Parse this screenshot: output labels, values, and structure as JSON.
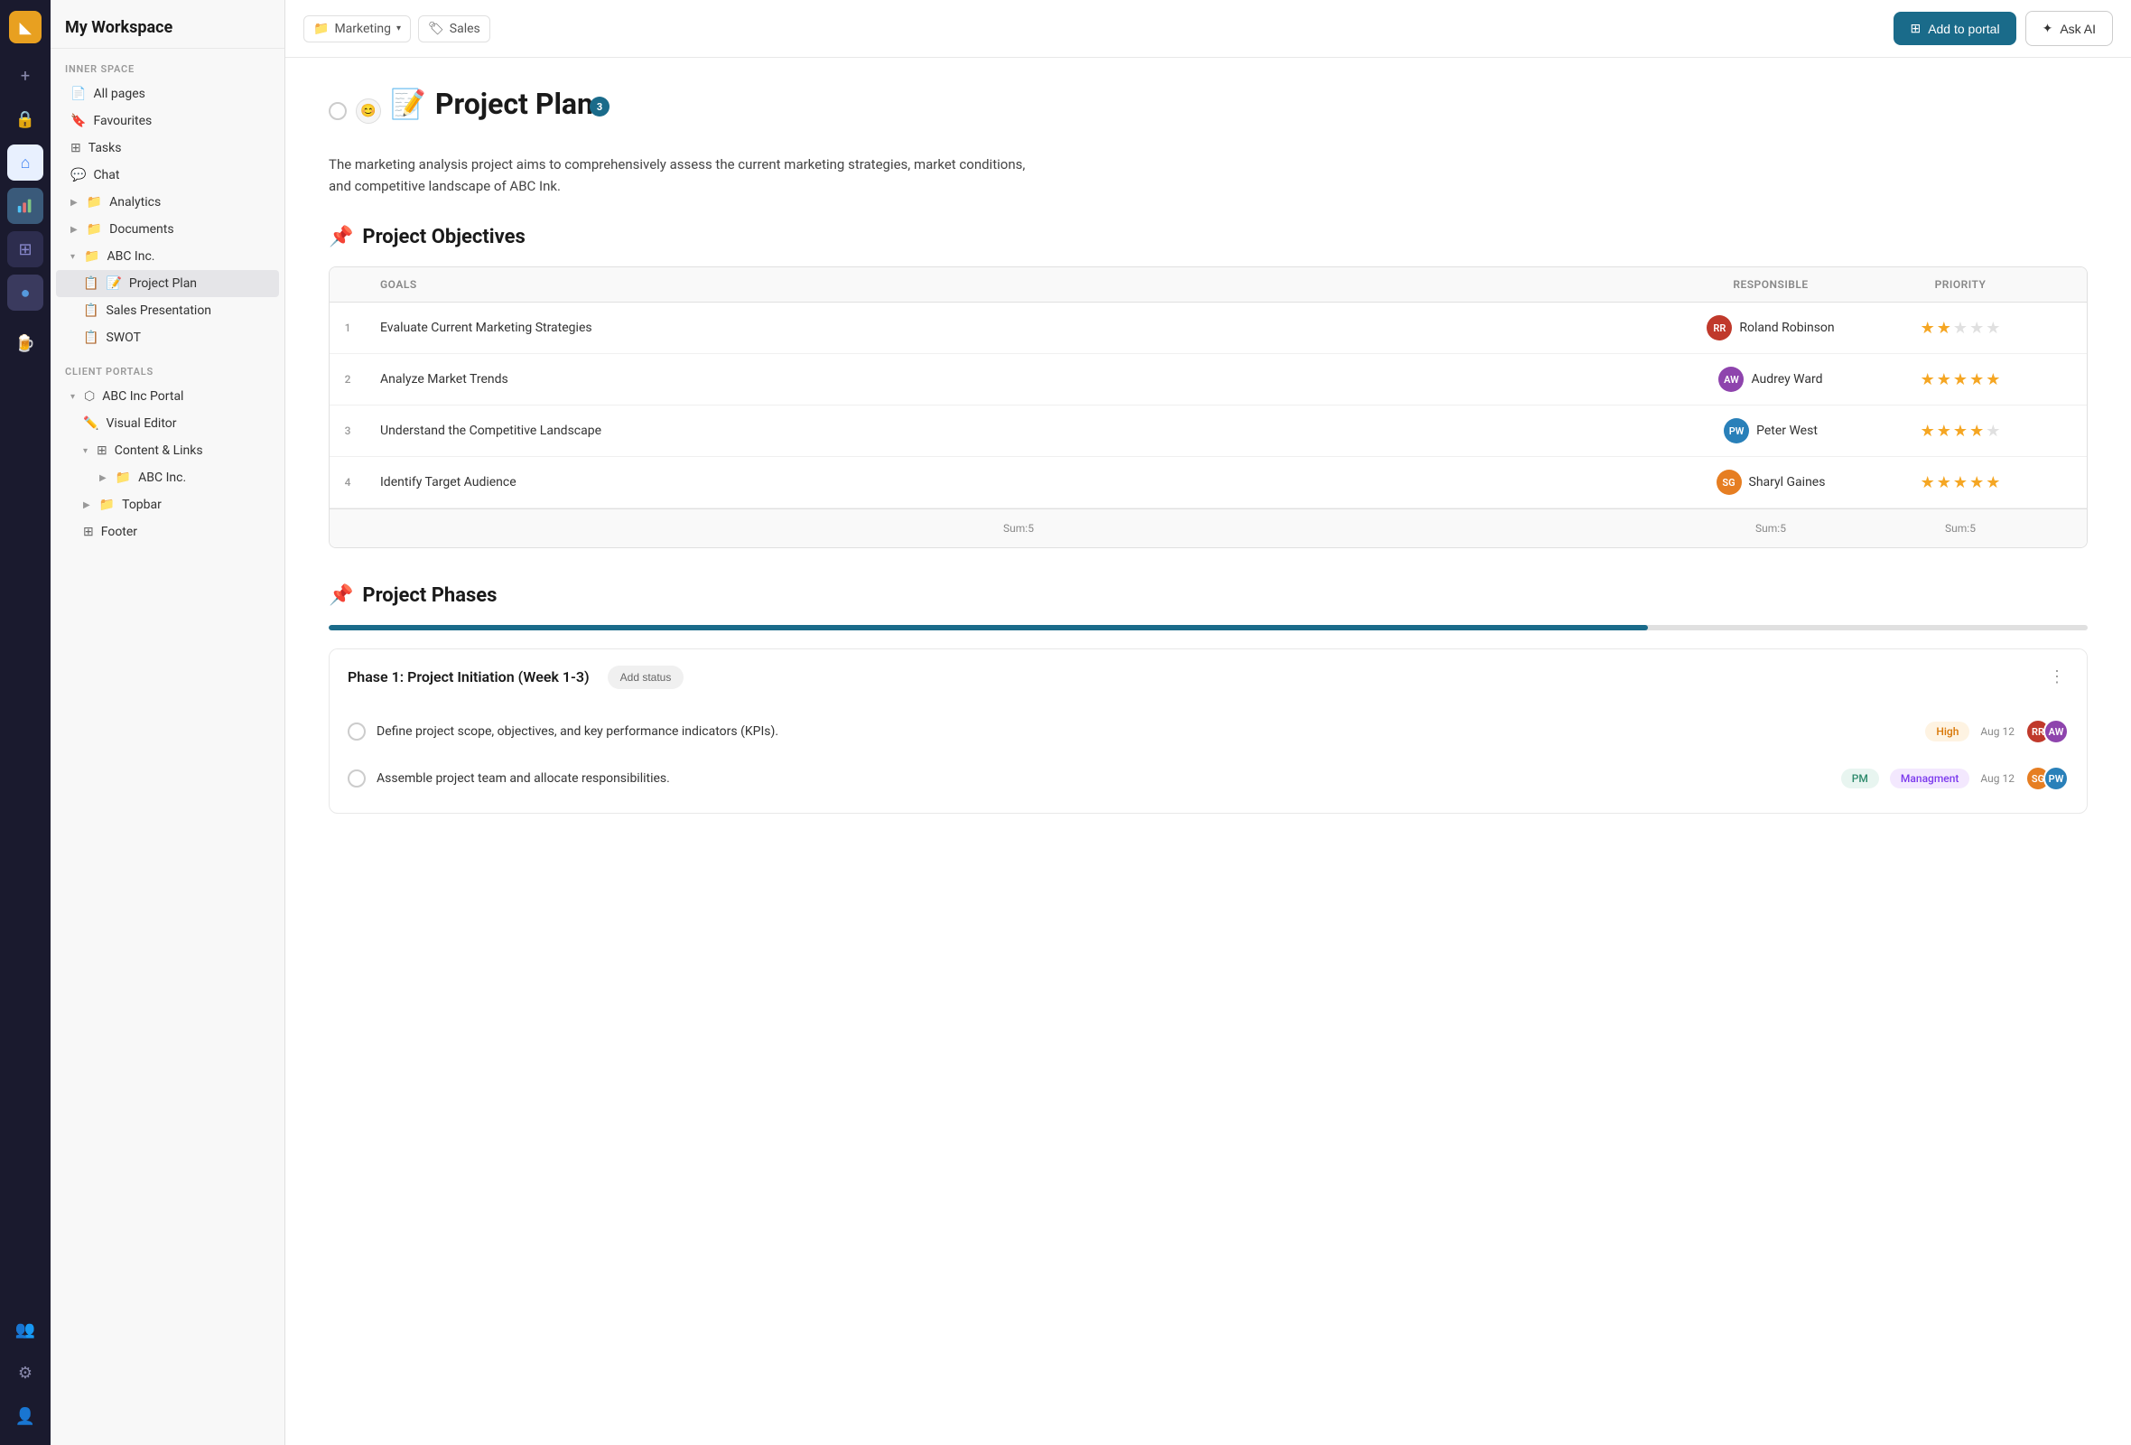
{
  "app": {
    "title": "My Workspace"
  },
  "rail": {
    "logo_letter": "◣",
    "icons": [
      {
        "name": "plus-icon",
        "symbol": "+",
        "active": false
      },
      {
        "name": "lock-icon",
        "symbol": "🔒",
        "active": false
      },
      {
        "name": "home-icon",
        "symbol": "⌂",
        "active": false
      },
      {
        "name": "chart-icon",
        "symbol": "📊",
        "active": true
      },
      {
        "name": "dashboard-icon",
        "symbol": "⊞",
        "active": false
      },
      {
        "name": "circle-icon",
        "symbol": "●",
        "active": false
      },
      {
        "name": "beer-icon",
        "symbol": "🍺",
        "active": false
      }
    ]
  },
  "sidebar": {
    "workspace_label": "My Workspace",
    "inner_space_label": "INNER SPACE",
    "items": [
      {
        "label": "All pages",
        "icon": "📄",
        "indent": 0
      },
      {
        "label": "Favourites",
        "icon": "🔖",
        "indent": 0
      },
      {
        "label": "Tasks",
        "icon": "⊞",
        "indent": 0
      },
      {
        "label": "Chat",
        "icon": "💬",
        "indent": 0
      },
      {
        "label": "Analytics",
        "icon": "📁",
        "indent": 0,
        "chevron": "▶"
      },
      {
        "label": "Documents",
        "icon": "📁",
        "indent": 0,
        "chevron": "▶"
      },
      {
        "label": "ABC Inc.",
        "icon": "📁",
        "indent": 0,
        "chevron": "▾",
        "expanded": true
      },
      {
        "label": "Project Plan",
        "icon": "📋",
        "indent": 1,
        "active": true,
        "emoji": "📝"
      },
      {
        "label": "Sales Presentation",
        "icon": "📋",
        "indent": 1
      },
      {
        "label": "SWOT",
        "icon": "📋",
        "indent": 1
      }
    ],
    "client_portals_label": "CLIENT PORTALS",
    "portal_items": [
      {
        "label": "ABC Inc Portal",
        "icon": "⬡",
        "indent": 0,
        "chevron": "▾"
      },
      {
        "label": "Visual Editor",
        "icon": "✏️",
        "indent": 1
      },
      {
        "label": "Content & Links",
        "icon": "⊞",
        "indent": 1,
        "chevron": "▾"
      },
      {
        "label": "ABC Inc.",
        "icon": "📁",
        "indent": 2,
        "chevron": "▶"
      },
      {
        "label": "Topbar",
        "icon": "📁",
        "indent": 1,
        "chevron": "▶"
      },
      {
        "label": "Footer",
        "icon": "⊞",
        "indent": 1
      }
    ]
  },
  "topbar": {
    "breadcrumb_icon": "📁",
    "breadcrumb_label": "Marketing",
    "breadcrumb_chevron": "▾",
    "tag_icon": "🏷",
    "tag_label": "Sales",
    "add_to_portal_label": "Add to portal",
    "ask_ai_label": "Ask AI"
  },
  "page": {
    "emoji": "📝",
    "title": "Project Plan",
    "description": "The marketing analysis project aims to comprehensively assess the current marketing strategies, market conditions, and competitive landscape of ABC Ink.",
    "notification_count": "3",
    "objectives": {
      "heading": "Project Objectives",
      "heading_emoji": "📌",
      "columns": [
        "GOALS",
        "RESPONSIBLE",
        "PRIORITY"
      ],
      "rows": [
        {
          "num": "1",
          "goal": "Evaluate Current Marketing Strategies",
          "responsible": "Roland Robinson",
          "avatar_color": "#c0392b",
          "avatar_initials": "RR",
          "stars_filled": 2,
          "stars_total": 5
        },
        {
          "num": "2",
          "goal": "Analyze Market Trends",
          "responsible": "Audrey Ward",
          "avatar_color": "#8e44ad",
          "avatar_initials": "AW",
          "stars_filled": 5,
          "stars_total": 5
        },
        {
          "num": "3",
          "goal": "Understand the Competitive Landscape",
          "responsible": "Peter West",
          "avatar_color": "#2980b9",
          "avatar_initials": "PW",
          "stars_filled": 4,
          "stars_total": 5
        },
        {
          "num": "4",
          "goal": "Identify Target Audience",
          "responsible": "Sharyl Gaines",
          "avatar_color": "#e67e22",
          "avatar_initials": "SG",
          "stars_filled": 5,
          "stars_total": 5
        }
      ],
      "sums": [
        "Sum:5",
        "Sum:5",
        "Sum:5",
        "Sum:5"
      ]
    },
    "phases": {
      "heading": "Project Phases",
      "heading_emoji": "📌",
      "progress": 75,
      "cards": [
        {
          "title": "Phase 1: Project Initiation (Week 1-3)",
          "status_label": "Add status",
          "items": [
            {
              "text": "Define project scope, objectives, and key performance indicators (KPIs).",
              "tags": [
                {
                  "label": "High",
                  "type": "high"
                }
              ],
              "date": "Aug 12",
              "avatars": [
                {
                  "initials": "RR",
                  "color": "#c0392b"
                },
                {
                  "initials": "AW",
                  "color": "#8e44ad"
                }
              ]
            },
            {
              "text": "Assemble project team and allocate responsibilities.",
              "tags": [
                {
                  "label": "PM",
                  "type": "pm"
                },
                {
                  "label": "Managment",
                  "type": "management"
                }
              ],
              "date": "Aug 12",
              "avatars": [
                {
                  "initials": "SG",
                  "color": "#e67e22"
                },
                {
                  "initials": "PW",
                  "color": "#2980b9"
                }
              ]
            }
          ]
        }
      ]
    }
  }
}
